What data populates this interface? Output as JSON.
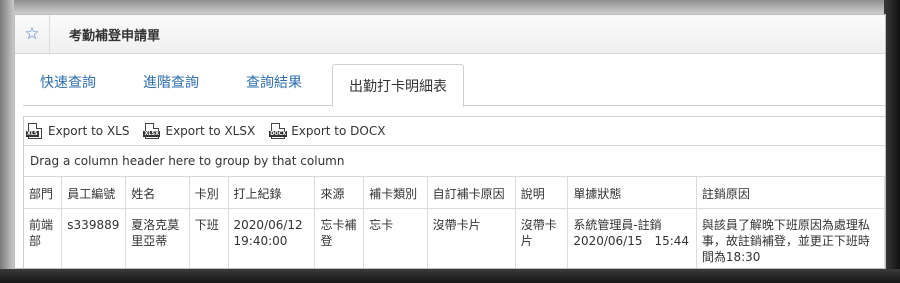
{
  "window": {
    "title": "考勤補登申請單",
    "star_icon": "star-icon"
  },
  "tabs": [
    {
      "label": "快速查詢",
      "active": false
    },
    {
      "label": "進階查詢",
      "active": false
    },
    {
      "label": "查詢結果",
      "active": false
    },
    {
      "label": "出勤打卡明細表",
      "active": true
    }
  ],
  "exports": [
    {
      "label": "Export to XLS",
      "icon": "XLS"
    },
    {
      "label": "Export to XLSX",
      "icon": "XLSX"
    },
    {
      "label": "Export to DOCX",
      "icon": "DOCX"
    }
  ],
  "group_hint": "Drag a column header here to group by that column",
  "table": {
    "columns": [
      "部門",
      "員工編號",
      "姓名",
      "卡別",
      "打上紀錄",
      "來源",
      "補卡類別",
      "自訂補卡原因",
      "說明",
      "單據狀態",
      "註銷原因"
    ],
    "rows": [
      [
        "前端部",
        "s339889",
        "夏洛克莫里亞蒂",
        "下班",
        "2020/06/12 19:40:00",
        "忘卡補登",
        "忘卡",
        "沒帶卡片",
        "沒帶卡片",
        "系統管理員-註銷 2020/06/15　15:44",
        "與該員了解晚下班原因為處理私事，故註銷補登，並更正下班時間為18:30"
      ]
    ]
  }
}
